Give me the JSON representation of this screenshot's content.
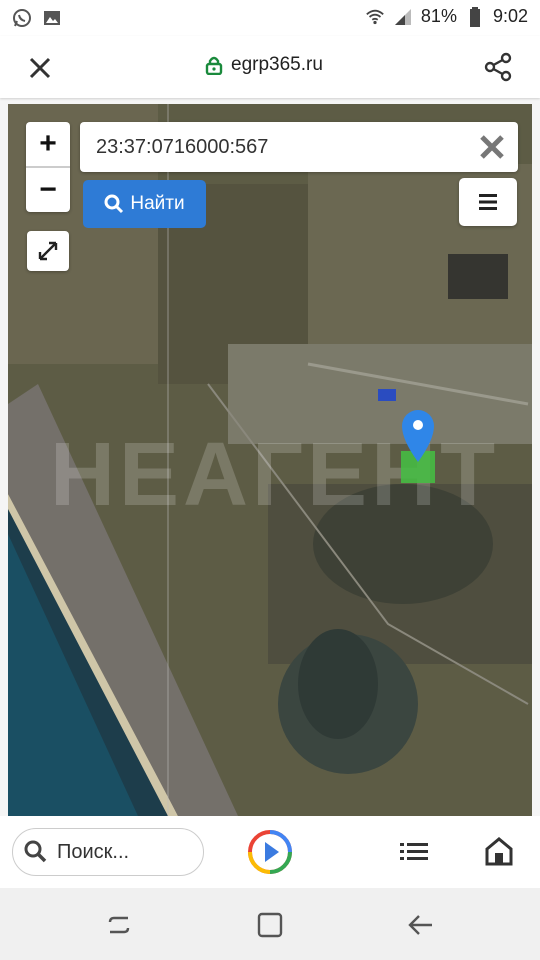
{
  "status": {
    "battery": "81%",
    "time": "9:02"
  },
  "browser": {
    "url": "egrp365.ru"
  },
  "map": {
    "search_value": "23:37:0716000:567",
    "find_label": "Найти",
    "zoom_in": "+",
    "zoom_out": "−",
    "watermark": "НЕАГЕНТ",
    "parcel_color": "#44c043",
    "pin_color": "#2f86e8"
  },
  "bottom": {
    "search_label": "Поиск..."
  }
}
